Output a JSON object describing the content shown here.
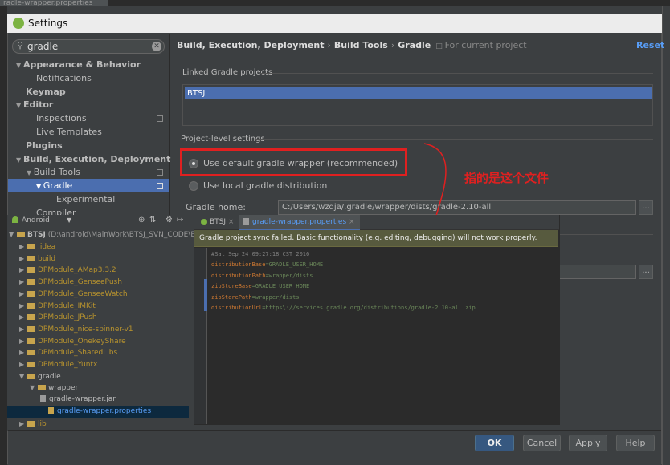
{
  "background_ide": {
    "tab_label": "radle-wrapper.properties"
  },
  "dialog": {
    "title": "Settings",
    "search": {
      "value": "gradle"
    },
    "tree": [
      {
        "label": "Appearance & Behavior",
        "bold": true,
        "expanded": true
      },
      {
        "label": "Notifications",
        "bold": false
      },
      {
        "label": "Keymap",
        "bold": true
      },
      {
        "label": "Editor",
        "bold": true,
        "expanded": true
      },
      {
        "label": "Inspections",
        "bold": false
      },
      {
        "label": "Live Templates",
        "bold": false
      },
      {
        "label": "Plugins",
        "bold": true
      },
      {
        "label": "Build, Execution, Deployment",
        "bold": true,
        "expanded": true
      },
      {
        "label": "Build Tools",
        "bold": false,
        "expanded": true
      },
      {
        "label": "Gradle",
        "bold": false,
        "selected": true
      },
      {
        "label": "Experimental",
        "bold": false
      },
      {
        "label": "Compiler",
        "bold": false
      }
    ],
    "breadcrumb": [
      "Build, Execution, Deployment",
      "Build Tools",
      "Gradle"
    ],
    "breadcrumb_sep": "›",
    "breadcrumb_note": "For current project",
    "reset_label": "Reset",
    "linked_projects_title": "Linked Gradle projects",
    "linked_projects": [
      "BTSJ"
    ],
    "project_level_title": "Project-level settings",
    "options": [
      {
        "label": "Use default gradle wrapper (recommended)",
        "selected": true
      },
      {
        "label": "Use local gradle distribution",
        "selected": false
      }
    ],
    "gradle_home_label": "Gradle home:",
    "gradle_home_value": "C:/Users/wzqja/.gradle/wrapper/dists/gradle-2.10-all",
    "browse_label": "...",
    "buttons": {
      "ok": "OK",
      "cancel": "Cancel",
      "apply": "Apply",
      "help": "Help"
    }
  },
  "annotation": {
    "text": "指的是这个文件",
    "color": "#e02020"
  },
  "project_panel": {
    "view_selector": "Android",
    "root": "BTSJ",
    "root_path": "(D:\\android\\MainWork\\BTSJ_SVN_CODE\\B",
    "items": [
      {
        "label": ".idea",
        "type": "folder"
      },
      {
        "label": "build",
        "type": "folder"
      },
      {
        "label": "DPModule_AMap3.3.2",
        "type": "folder"
      },
      {
        "label": "DPModule_GenseePush",
        "type": "folder"
      },
      {
        "label": "DPModule_GenseeWatch",
        "type": "folder"
      },
      {
        "label": "DPModule_IMKit",
        "type": "folder"
      },
      {
        "label": "DPModule_JPush",
        "type": "folder"
      },
      {
        "label": "DPModule_nice-spinner-v1",
        "type": "folder"
      },
      {
        "label": "DPModule_OnekeyShare",
        "type": "folder"
      },
      {
        "label": "DPModule_SharedLibs",
        "type": "folder"
      },
      {
        "label": "DPModule_Yuntx",
        "type": "folder"
      },
      {
        "label": "gradle",
        "type": "folder"
      },
      {
        "label": "wrapper",
        "type": "folder"
      },
      {
        "label": "gradle-wrapper.jar",
        "type": "file"
      },
      {
        "label": "gradle-wrapper.properties",
        "type": "file"
      },
      {
        "label": "lib",
        "type": "folder"
      }
    ]
  },
  "editor": {
    "tabs": [
      {
        "label": "BTSJ",
        "close": "×"
      },
      {
        "label": "gradle-wrapper.properties",
        "close": "×"
      }
    ],
    "banner": "Gradle project sync failed. Basic functionality (e.g. editing, debugging) will not work properly.",
    "code_lines": [
      {
        "key": "#Sat Sep 24 09:27:18 CST 2016",
        "val": ""
      },
      {
        "key": "distributionBase",
        "val": "=GRADLE_USER_HOME"
      },
      {
        "key": "distributionPath",
        "val": "=wrapper/dists"
      },
      {
        "key": "zipStoreBase",
        "val": "=GRADLE_USER_HOME"
      },
      {
        "key": "zipStorePath",
        "val": "=wrapper/dists"
      },
      {
        "key": "distributionUrl",
        "val": "=https\\://services.gradle.org/distributions/gradle-2.10-all.zip"
      }
    ]
  },
  "colors": {
    "accent": "#4b6eaf",
    "annotation_red": "#e02020",
    "link": "#589df6"
  }
}
